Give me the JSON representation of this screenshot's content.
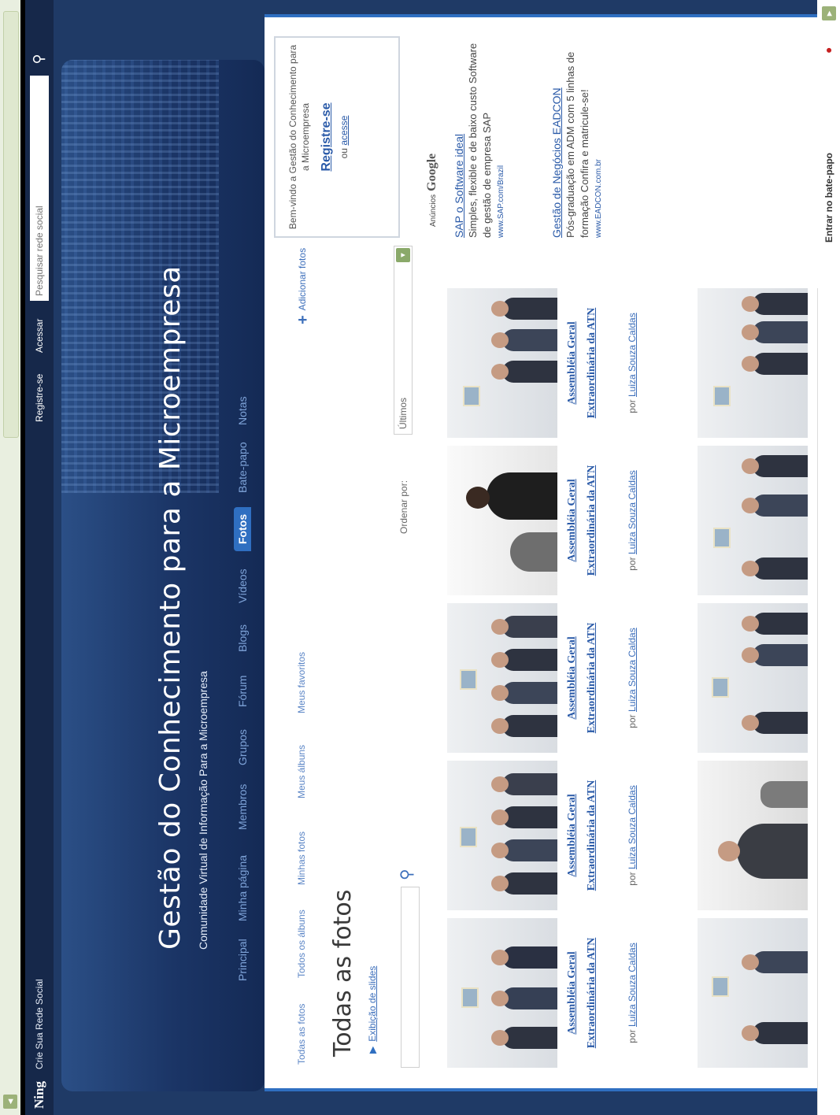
{
  "ningbar": {
    "logo": "Ning",
    "create": "Crie Sua Rede Social",
    "register": "Registre-se",
    "login": "Acessar",
    "search_placeholder": "Pesquisar rede social"
  },
  "header": {
    "title": "Gestão do Conhecimento para a Microempresa",
    "subtitle": "Comunidade Virtual de Informação Para a Microempresa"
  },
  "nav": {
    "items": [
      "Principal",
      "Minha página",
      "Membros",
      "Grupos",
      "Fórum",
      "Blogs",
      "Vídeos",
      "Fotos",
      "Bate-papo",
      "Notas"
    ],
    "active": "Fotos"
  },
  "photos_page": {
    "sub_links": [
      "Todas as fotos",
      "Todos os álbuns",
      "Minhas fotos",
      "Meus álbuns",
      "Meus favoritos"
    ],
    "add_photos": "Adicionar fotos",
    "title": "Todas as fotos",
    "slideshow": "Exibição de slides",
    "sort_label": "Ordenar por:",
    "sort_value": "Últimos",
    "photos": [
      {
        "caption": "Assembléia Geral Extraordinária da ATN",
        "by_prefix": "por",
        "author": "Luiza Souza Caldas"
      },
      {
        "caption": "Assembléia Geral Extraordinária da ATN",
        "by_prefix": "por",
        "author": "Luiza Souza Caldas"
      },
      {
        "caption": "Assembléia Geral Extraordinária da ATN",
        "by_prefix": "por",
        "author": "Luiza Souza Caldas"
      },
      {
        "caption": "Assembléia Geral Extraordinária da ATN",
        "by_prefix": "por",
        "author": "Luiza Souza Caldas"
      },
      {
        "caption": "Assembléia Geral Extraordinária da ATN",
        "by_prefix": "por",
        "author": "Luiza Souza Caldas"
      }
    ]
  },
  "welcome": {
    "text": "Bem-vindo a Gestão do Conhecimento para a Microempresa",
    "register": "Registre-se",
    "or": "ou",
    "login": "acesse"
  },
  "ads": {
    "label": "Anúncios",
    "brand": "Google",
    "items": [
      {
        "title": "SAP o Software ideal",
        "body": "Simples, flexible e de baixo custo Software de gestão de empresa SAP",
        "url": "www.SAP.com/Brazil"
      },
      {
        "title": "Gestão de Negócios EADCON",
        "body": "Pós-graduação em ADM com 5 linhas de formação Confira e matricule-se!",
        "url": "www.EADCON.com.br"
      }
    ]
  },
  "chat": {
    "label": "Entrar no bate-papo"
  }
}
